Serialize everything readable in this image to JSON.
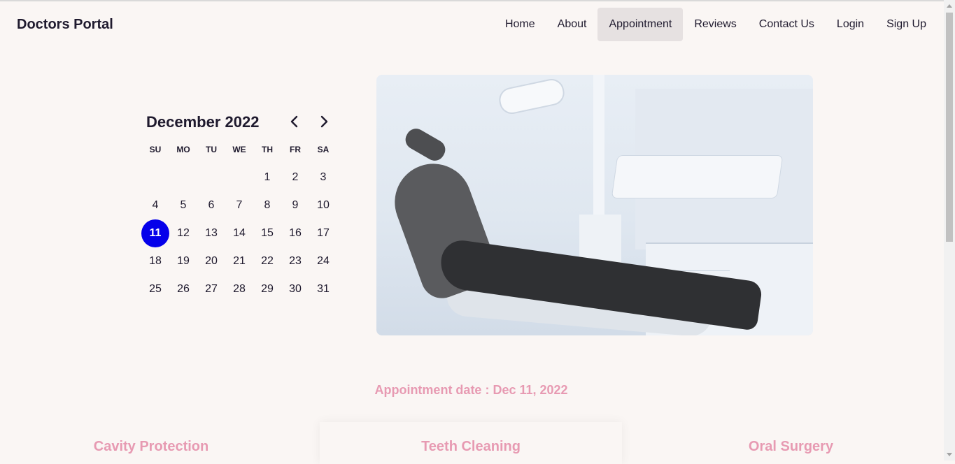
{
  "header": {
    "brand": "Doctors Portal",
    "nav": [
      "Home",
      "About",
      "Appointment",
      "Reviews",
      "Contact Us",
      "Login",
      "Sign Up"
    ],
    "active_nav": "Appointment"
  },
  "calendar": {
    "month_label": "December 2022",
    "weekdays": [
      "SU",
      "MO",
      "TU",
      "WE",
      "TH",
      "FR",
      "SA"
    ],
    "days": [
      [
        "",
        "",
        "",
        "",
        "1",
        "2",
        "3"
      ],
      [
        "4",
        "5",
        "6",
        "7",
        "8",
        "9",
        "10"
      ],
      [
        "11",
        "12",
        "13",
        "14",
        "15",
        "16",
        "17"
      ],
      [
        "18",
        "19",
        "20",
        "21",
        "22",
        "23",
        "24"
      ],
      [
        "25",
        "26",
        "27",
        "28",
        "29",
        "30",
        "31"
      ]
    ],
    "selected_day": "11",
    "selected_color": "#0500ea",
    "prev_icon": "chevron-left-icon",
    "next_icon": "chevron-right-icon"
  },
  "hero_image": {
    "subject": "dental-chair"
  },
  "appointment": {
    "date_text": "Appointment date : Dec 11, 2022"
  },
  "services": [
    "Cavity Protection",
    "Teeth Cleaning",
    "Oral Surgery"
  ],
  "colors": {
    "accent_pink": "#e79ab2",
    "selected_day": "#0500ea",
    "background": "#faf6f4"
  }
}
